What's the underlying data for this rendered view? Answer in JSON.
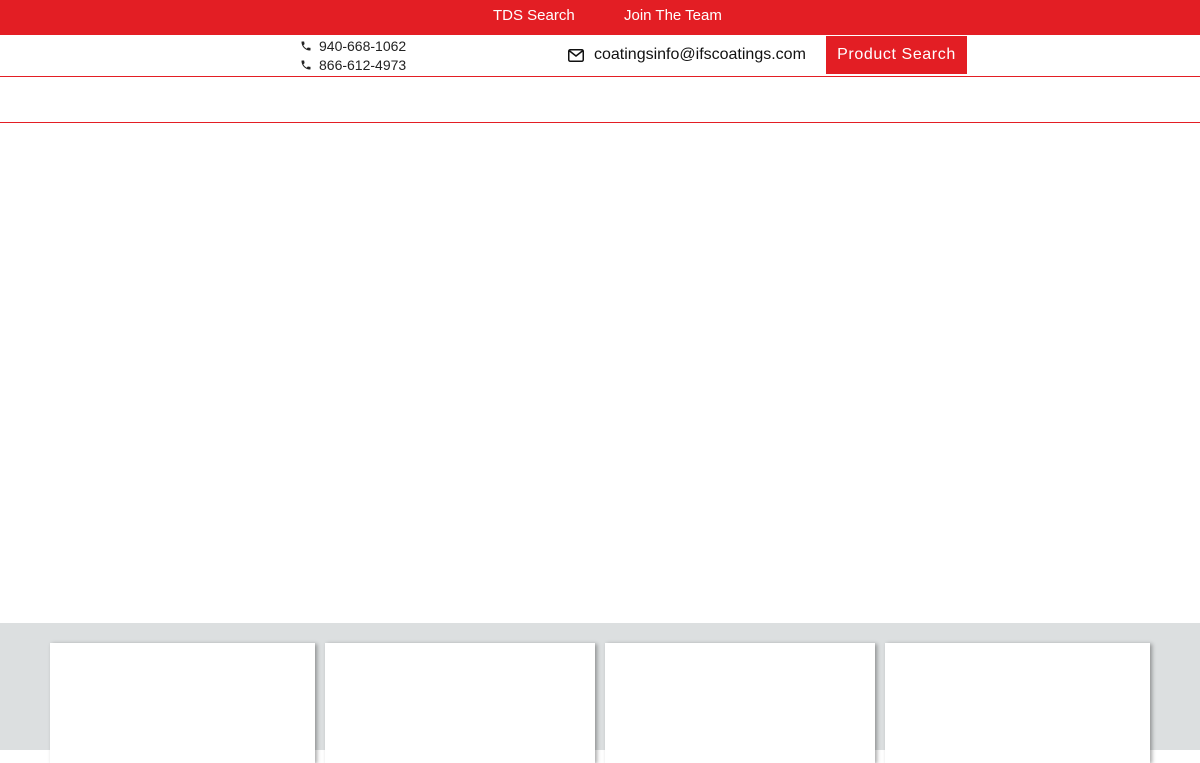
{
  "topbar": {
    "links": [
      {
        "label": "TDS Search"
      },
      {
        "label": "Join The Team"
      }
    ],
    "background": "#e31e24"
  },
  "contact": {
    "phones": [
      {
        "number": "940-668-1062",
        "icon": "phone-icon"
      },
      {
        "number": "866-612-4973",
        "icon": "phone-icon"
      }
    ],
    "email": {
      "address": "coatingsinfo@ifscoatings.com",
      "icon": "envelope-icon"
    },
    "product_search_label": "Product Search"
  },
  "colors": {
    "accent": "#e31e24",
    "cards_background": "#dcdfe0"
  }
}
